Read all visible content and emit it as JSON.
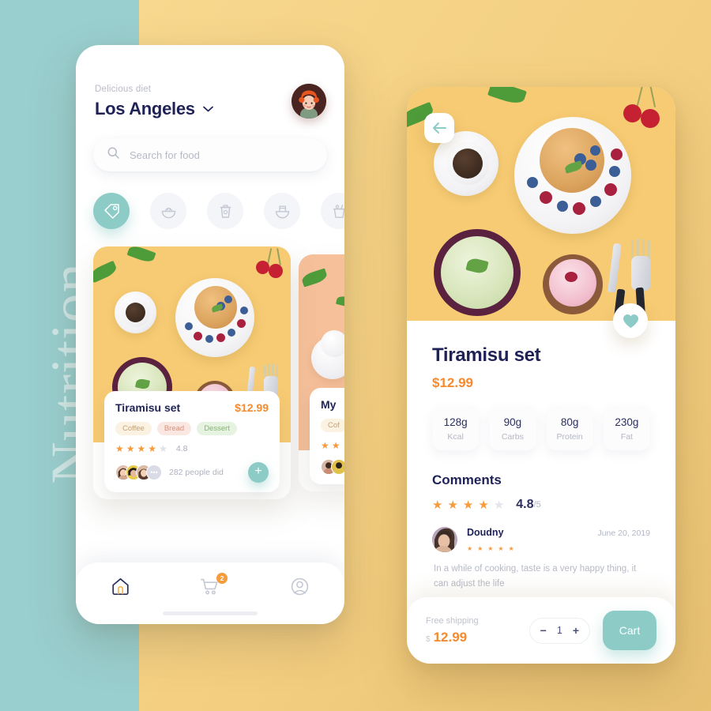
{
  "background": {
    "brand_word": "Nutrition",
    "teal": "#99CFCF",
    "yellow": "#F5D287"
  },
  "left_phone": {
    "header": {
      "eyebrow": "Delicious diet",
      "city": "Los Angeles",
      "chevron": "chevron-down",
      "avatar": "user-avatar"
    },
    "search": {
      "placeholder": "Search for food",
      "icon": "search-icon"
    },
    "categories": [
      {
        "name": "tag",
        "active": true
      },
      {
        "name": "rice-bowl",
        "active": false
      },
      {
        "name": "cup",
        "active": false
      },
      {
        "name": "noodle-bowl",
        "active": false
      },
      {
        "name": "drink",
        "active": false
      }
    ],
    "cards": [
      {
        "title": "Tiramisu set",
        "price": "$12.99",
        "tags": [
          "Coffee",
          "Bread",
          "Dessert"
        ],
        "rating_filled": 4,
        "rating_total": 5,
        "rating_value": "4.8",
        "people": "282 people did",
        "add_label": "+"
      },
      {
        "title": "My",
        "price": "",
        "tags": [
          "Cof"
        ],
        "rating_filled": 1,
        "rating_total": 5,
        "rating_value": "",
        "people": "",
        "add_label": ""
      }
    ],
    "tabbar": [
      {
        "name": "home",
        "active": true,
        "badge": ""
      },
      {
        "name": "cart",
        "active": false,
        "badge": "2"
      },
      {
        "name": "profile",
        "active": false,
        "badge": ""
      }
    ]
  },
  "right_phone": {
    "back_icon": "arrow-left",
    "favorite_icon": "heart",
    "title": "Tiramisu set",
    "price": "$12.99",
    "nutrition": [
      {
        "value": "128g",
        "label": "Kcal"
      },
      {
        "value": "90g",
        "label": "Carbs"
      },
      {
        "value": "80g",
        "label": "Protein"
      },
      {
        "value": "230g",
        "label": "Fat"
      }
    ],
    "comments": {
      "heading": "Comments",
      "rating_filled": 4,
      "rating_total": 5,
      "score": "4.8",
      "score_suffix": "/5",
      "items": [
        {
          "author": "Doudny",
          "date": "June 20, 2019",
          "stars": 5,
          "text": "In a while of cooking, taste is a very happy thing, it can adjust the life"
        }
      ]
    },
    "buybar": {
      "shipping": "Free shipping",
      "currency": "$",
      "price": "12.99",
      "minus": "−",
      "quantity": "1",
      "plus": "+",
      "cart_label": "Cart"
    }
  }
}
